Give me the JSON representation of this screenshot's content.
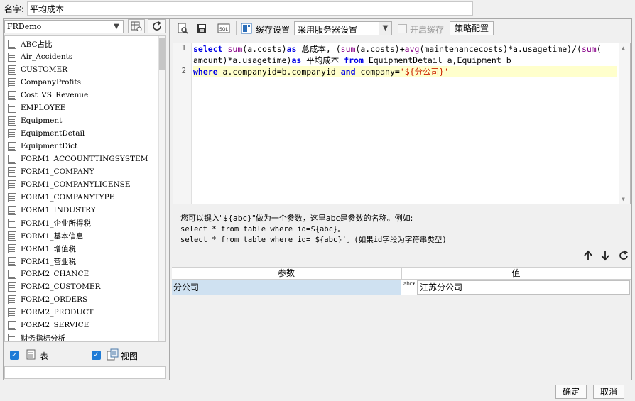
{
  "name_row": {
    "label": "名字:",
    "value": "平均成本"
  },
  "left": {
    "db_select": "FRDemo",
    "tables": [
      "ABC占比",
      "Air_Accidents",
      "CUSTOMER",
      "CompanyProfits",
      "Cost_VS_Revenue",
      "EMPLOYEE",
      "Equipment",
      "EquipmentDetail",
      "EquipmentDict",
      "FORM1_ACCOUNTTINGSYSTEM",
      "FORM1_COMPANY",
      "FORM1_COMPANYLICENSE",
      "FORM1_COMPANYTYPE",
      "FORM1_INDUSTRY",
      "FORM1_企业所得税",
      "FORM1_基本信息",
      "FORM1_增值税",
      "FORM1_营业税",
      "FORM2_CHANCE",
      "FORM2_CUSTOMER",
      "FORM2_ORDERS",
      "FORM2_PRODUCT",
      "FORM2_SERVICE",
      "财务指标分析"
    ],
    "table_check_label": "表",
    "view_check_label": "视图"
  },
  "toolbar": {
    "cache_label": "缓存设置",
    "server_select": "采用服务器设置",
    "enable_cache": "开启缓存",
    "strategy_button": "策略配置"
  },
  "editor": {
    "line_numbers": [
      "1",
      "2"
    ]
  },
  "hint": {
    "line1": "您可以键入\"${abc}\"做为一个参数，这里abc是参数的名称。例如:",
    "line2": "select * from table where id=${abc}。",
    "line3": "select * from table where id='${abc}'。(如果id字段为字符串类型)"
  },
  "params": {
    "header_name": "参数",
    "header_value": "值",
    "rows": [
      {
        "name": "分公司",
        "type": "abc",
        "value": "江苏分公司"
      }
    ]
  },
  "buttons": {
    "ok": "确定",
    "cancel": "取消"
  },
  "colors": {
    "selection": "#cfe1f1",
    "checkbox": "#1e7bd6",
    "keyword": "#0000e6",
    "string": "#cc2200",
    "highlight_line": "#ffffcc"
  }
}
